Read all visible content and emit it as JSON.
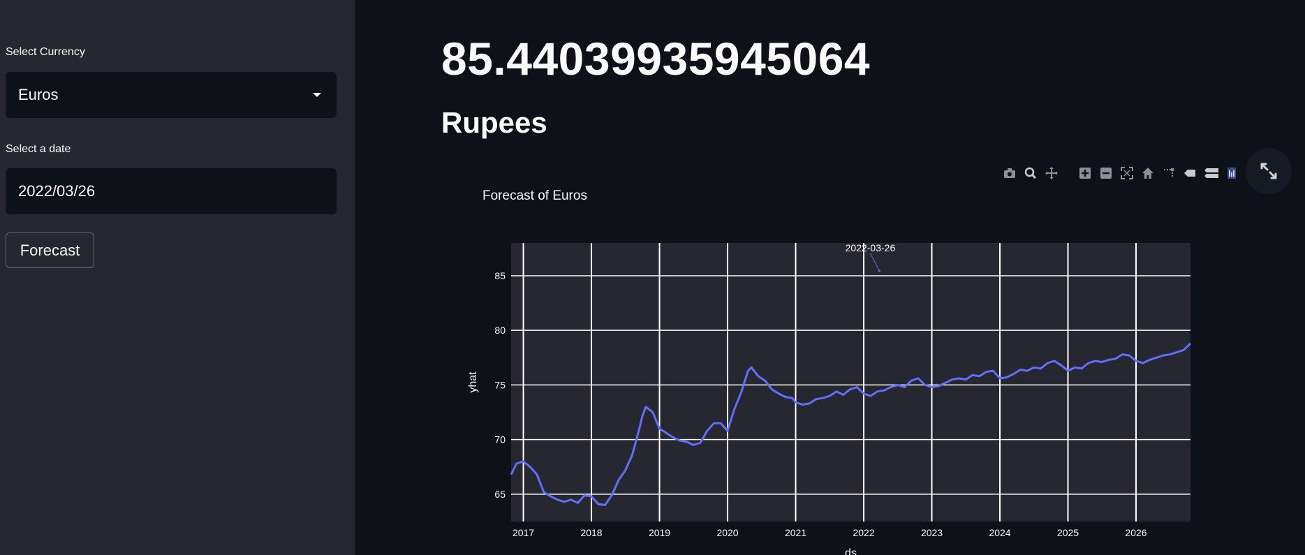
{
  "sidebar": {
    "currency_label": "Select Currency",
    "currency_value": "Euros",
    "date_label": "Select a date",
    "date_value": "2022/03/26",
    "forecast_button": "Forecast"
  },
  "main": {
    "value": "85.44039935945064",
    "unit": "Rupees"
  },
  "modebar": {
    "icons": [
      "camera-icon",
      "zoom-icon",
      "pan-icon",
      "zoom-in-icon",
      "zoom-out-icon",
      "autoscale-icon",
      "home-icon",
      "spike-lines-icon",
      "hover-closest-icon",
      "hover-compare-icon",
      "plotly-logo-icon"
    ]
  },
  "colors": {
    "sidebar_bg": "#262730",
    "main_bg": "#0e1117",
    "plot_bg": "#262730",
    "line": "#636efa"
  },
  "chart_data": {
    "type": "line",
    "title": "Forecast of Euros",
    "xlabel": "ds",
    "ylabel": "yhat",
    "xlim": [
      2016.82,
      2026.8
    ],
    "ylim": [
      62.5,
      88
    ],
    "x_ticks": [
      2017,
      2018,
      2019,
      2020,
      2021,
      2022,
      2023,
      2024,
      2025,
      2026
    ],
    "x_tick_labels": [
      "2017",
      "2018",
      "2019",
      "2020",
      "2021",
      "2022",
      "2023",
      "2024",
      "2025",
      "2026"
    ],
    "y_ticks": [
      65,
      70,
      75,
      80,
      85
    ],
    "y_tick_labels": [
      "65",
      "70",
      "75",
      "80",
      "85"
    ],
    "grid": true,
    "annotation": {
      "text": "2022-03-26",
      "x": 2022.23,
      "y": 85.44
    },
    "series": [
      {
        "x": [
          2016.82,
          2016.9,
          2017.0,
          2017.1,
          2017.2,
          2017.3,
          2017.4,
          2017.5,
          2017.6,
          2017.7,
          2017.8,
          2017.9,
          2018.0,
          2018.1,
          2018.2,
          2018.3,
          2018.4,
          2018.5,
          2018.6,
          2018.7,
          2018.75,
          2018.8,
          2018.9,
          2019.0,
          2019.1,
          2019.2,
          2019.3,
          2019.4,
          2019.5,
          2019.6,
          2019.7,
          2019.8,
          2019.9,
          2020.0,
          2020.1,
          2020.2,
          2020.3,
          2020.35,
          2020.45,
          2020.55,
          2020.65,
          2020.75,
          2020.85,
          2020.95,
          2021.0,
          2021.1,
          2021.2,
          2021.3,
          2021.4,
          2021.5,
          2021.6,
          2021.7,
          2021.8,
          2021.9,
          2022.0,
          2022.1,
          2022.2,
          2022.3,
          2022.4,
          2022.5,
          2022.6,
          2022.7,
          2022.8,
          2022.9,
          2023.0,
          2023.1,
          2023.2,
          2023.3,
          2023.4,
          2023.5,
          2023.6,
          2023.7,
          2023.8,
          2023.9,
          2024.0,
          2024.1,
          2024.2,
          2024.3,
          2024.4,
          2024.5,
          2024.6,
          2024.7,
          2024.8,
          2024.9,
          2025.0,
          2025.1,
          2025.2,
          2025.3,
          2025.4,
          2025.5,
          2025.6,
          2025.7,
          2025.8,
          2025.9,
          2026.0,
          2026.1,
          2026.2,
          2026.3,
          2026.4,
          2026.5,
          2026.6,
          2026.7,
          2026.8
        ],
        "values": [
          66.8,
          67.8,
          68.0,
          67.5,
          66.8,
          65.2,
          64.8,
          64.5,
          64.3,
          64.5,
          64.2,
          64.9,
          64.8,
          64.1,
          64.0,
          64.9,
          66.3,
          67.2,
          68.6,
          70.9,
          72.2,
          73.0,
          72.5,
          71.0,
          70.6,
          70.2,
          69.9,
          69.8,
          69.5,
          69.7,
          70.8,
          71.5,
          71.5,
          70.8,
          72.8,
          74.3,
          76.3,
          76.6,
          75.8,
          75.4,
          74.6,
          74.2,
          73.9,
          73.8,
          73.4,
          73.2,
          73.3,
          73.7,
          73.8,
          74.0,
          74.4,
          74.1,
          74.6,
          74.8,
          74.2,
          74.0,
          74.4,
          74.5,
          74.8,
          75.0,
          74.8,
          75.4,
          75.6,
          75.0,
          74.8,
          74.9,
          75.2,
          75.5,
          75.6,
          75.5,
          75.9,
          75.8,
          76.2,
          76.3,
          75.6,
          75.7,
          76.0,
          76.4,
          76.3,
          76.6,
          76.5,
          77.0,
          77.2,
          76.8,
          76.3,
          76.6,
          76.5,
          77.0,
          77.2,
          77.1,
          77.3,
          77.4,
          77.8,
          77.7,
          77.2,
          77.0,
          77.3,
          77.5,
          77.7,
          77.8,
          78.0,
          78.2,
          78.8
        ]
      }
    ]
  }
}
